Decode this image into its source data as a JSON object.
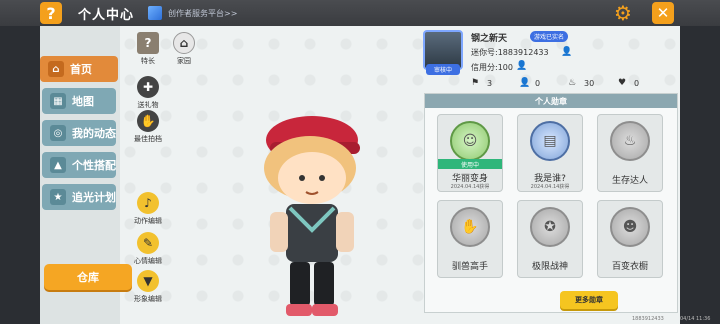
{
  "header": {
    "title": "个人中心",
    "creator_link": "创作者服务平台>>",
    "help_symbol": "?",
    "close_symbol": "✕",
    "settings_symbol": "⚙"
  },
  "nav": {
    "items": [
      {
        "label": "首页",
        "active": true
      },
      {
        "label": "地图"
      },
      {
        "label": "我的动态"
      },
      {
        "label": "个性搭配"
      },
      {
        "label": "追光计划"
      }
    ],
    "warehouse_label": "仓库"
  },
  "side_icons": {
    "specialty": "特长",
    "home": "家园",
    "gift": "送礼物",
    "best_shot": "最佳拍档",
    "action_edit": "动作编辑",
    "mood_edit": "心情编辑",
    "look_edit": "形象编辑"
  },
  "profile": {
    "nickname": "钢之新天",
    "verified_label": "游戏已实名",
    "mini_id": "迷你号:1883912433",
    "credit": "信用分:100",
    "review_badge": "审核中",
    "stats": [
      "3",
      "0",
      "30",
      "0"
    ]
  },
  "medals": {
    "header": "个人勋章",
    "in_use_label": "使用中",
    "items": [
      {
        "name": "华丽变身",
        "date": "2024.04.14获得",
        "in_use": true
      },
      {
        "name": "我是谁?",
        "date": "2024.04.14获得"
      },
      {
        "name": "生存达人",
        "date": ""
      },
      {
        "name": "驯兽高手",
        "date": ""
      },
      {
        "name": "极限战神",
        "date": ""
      },
      {
        "name": "百变衣橱",
        "date": ""
      }
    ],
    "more_label": "更多勋章"
  },
  "footer": {
    "id_text": "1883912433",
    "time_text": "04/14 11:36"
  }
}
